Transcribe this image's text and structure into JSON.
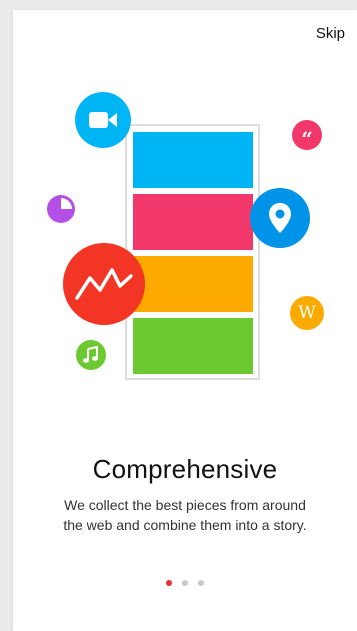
{
  "header": {
    "skip_label": "Skip"
  },
  "illustration": {
    "icons": [
      "video-camera-icon",
      "quote-icon",
      "pie-chart-icon",
      "location-pin-icon",
      "trend-line-icon",
      "wikipedia-icon",
      "music-note-icon"
    ],
    "wiki_letter": "W",
    "quote_glyph": "“",
    "colors": {
      "blue": "#00b5f4",
      "pink": "#f2376b",
      "orange": "#fdaa00",
      "green": "#6cc92f",
      "red": "#f23524",
      "purple": "#b44fe6",
      "pin_blue": "#0093e8"
    }
  },
  "content": {
    "title": "Comprehensive",
    "description": "We collect the best pieces from around the web and combine them into a story."
  },
  "pager": {
    "total": 3,
    "current": 1
  }
}
